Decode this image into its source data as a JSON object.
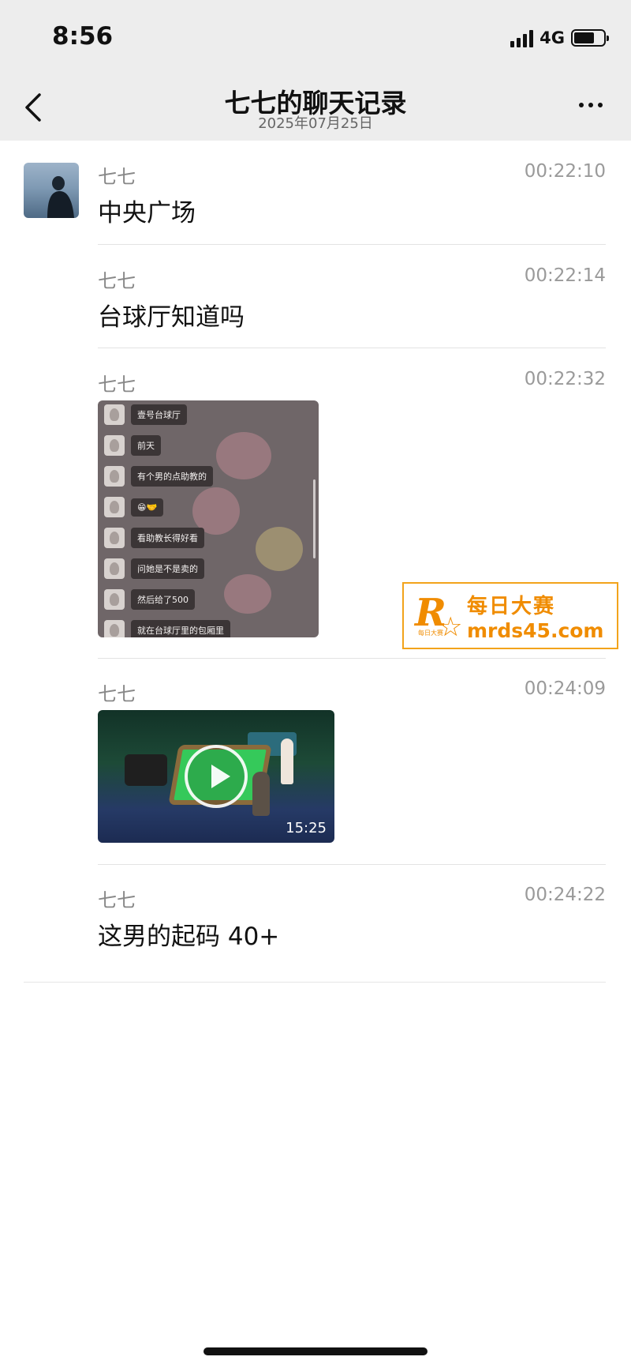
{
  "status_bar": {
    "time": "8:56",
    "network": "4G"
  },
  "nav": {
    "title": "七七的聊天记录",
    "subtitle": "2025年07月25日"
  },
  "messages": [
    {
      "sender": "七七",
      "time": "00:22:10",
      "text": "中央广场"
    },
    {
      "sender": "七七",
      "time": "00:22:14",
      "text": "台球厅知道吗"
    },
    {
      "sender": "七七",
      "time": "00:22:32",
      "type": "image",
      "image_lines": [
        "壹号台球厅",
        "前天",
        "有个男的点助教的",
        "😁🤝",
        "看助教长得好看",
        "问她是不是卖的",
        "然后给了500",
        "就在台球厅里的包厢里"
      ]
    },
    {
      "sender": "七七",
      "time": "00:24:09",
      "type": "video",
      "duration": "15:25"
    },
    {
      "sender": "七七",
      "time": "00:24:22",
      "text": "这男的起码 40+"
    }
  ],
  "watermark": {
    "logo_letter": "R",
    "name": "每日大赛",
    "url": "mrds45.com"
  },
  "colors": {
    "nav_background": "#ededed",
    "watermark_accent": "#f08c00",
    "video_table": "#35c95a"
  }
}
